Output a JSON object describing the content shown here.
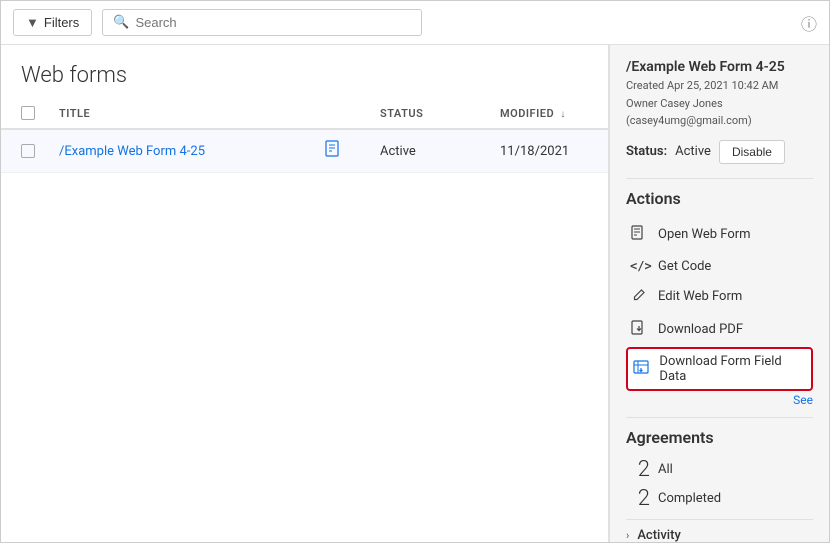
{
  "toolbar": {
    "filter_label": "Filters",
    "search_placeholder": "Search",
    "info_icon": "ⓘ"
  },
  "page": {
    "title": "Web forms"
  },
  "table": {
    "columns": [
      {
        "key": "checkbox",
        "label": ""
      },
      {
        "key": "title",
        "label": "Title"
      },
      {
        "key": "icon",
        "label": ""
      },
      {
        "key": "status",
        "label": "Status"
      },
      {
        "key": "modified",
        "label": "Modified"
      }
    ],
    "rows": [
      {
        "title": "/Example Web Form 4-25",
        "status": "Active",
        "modified": "11/18/2021"
      }
    ]
  },
  "panel": {
    "title": "/Example Web Form 4-25",
    "created": "Created Apr 25, 2021 10:42 AM",
    "owner": "Owner Casey Jones (casey4umg@gmail.com)",
    "status_label": "Status:",
    "status_value": "Active",
    "disable_label": "Disable",
    "actions_title": "Actions",
    "actions": [
      {
        "id": "open-web-form",
        "label": "Open Web Form",
        "icon": "📄"
      },
      {
        "id": "get-code",
        "label": "Get Code",
        "icon": "</>"
      },
      {
        "id": "edit-web-form",
        "label": "Edit Web Form",
        "icon": "✏️"
      },
      {
        "id": "download-pdf",
        "label": "Download PDF",
        "icon": "📥"
      },
      {
        "id": "download-form-field-data",
        "label": "Download Form Field Data",
        "icon": "📊",
        "highlighted": true
      }
    ],
    "see_more": "See",
    "agreements_title": "Agreements",
    "agreements": [
      {
        "count": "2",
        "label": "All"
      },
      {
        "count": "2",
        "label": "Completed"
      }
    ],
    "activity_label": "Activity"
  }
}
